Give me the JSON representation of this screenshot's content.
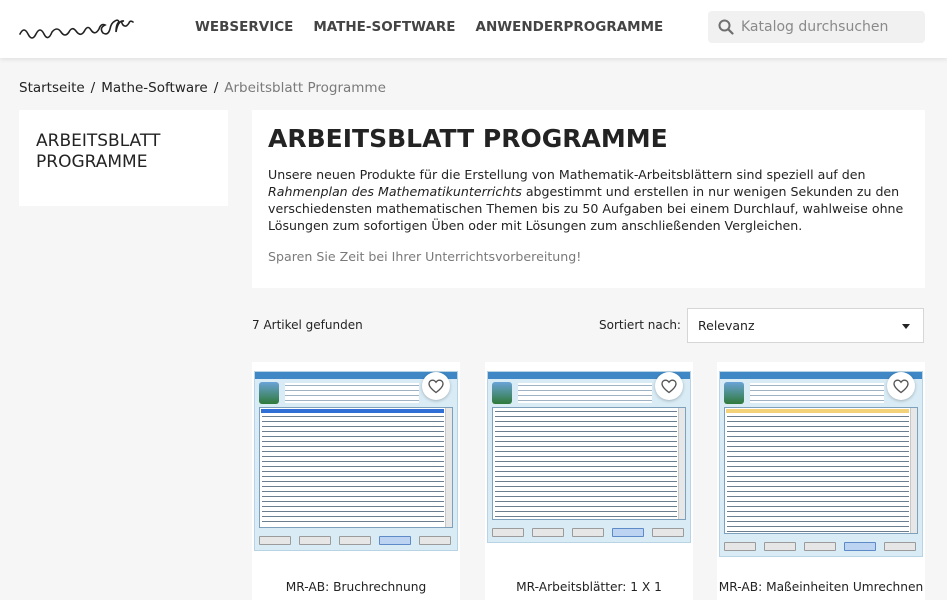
{
  "header": {
    "logo_text": "rumsoft",
    "nav": [
      "WEBSERVICE",
      "MATHE-SOFTWARE",
      "ANWENDERPROGRAMME"
    ],
    "search_placeholder": "Katalog durchsuchen"
  },
  "breadcrumb": {
    "items": [
      "Startseite",
      "Mathe-Software"
    ],
    "separator": "/",
    "current": "Arbeitsblatt Programme"
  },
  "sidebar": {
    "category_title": "ARBEITSBLATT PROGRAMME"
  },
  "category": {
    "title": "ARBEITSBLATT PROGRAMME",
    "desc_part1": "Unsere neuen Produkte für die Erstellung von Mathematik-Arbeitsblättern sind speziell auf den ",
    "desc_italic": "Rahmenplan des Mathematikunterrichts",
    "desc_part2": " abgestimmt und erstellen in nur wenigen Sekunden zu den verschiedensten mathematischen Themen bis zu 50 Aufgaben bei einem Durchlauf, wahlweise ohne Lösungen zum sofortigen Üben oder mit Lösungen zum anschließenden Vergleichen.",
    "tagline": "Sparen Sie Zeit bei Ihrer Unterrichtsvorbereitung!"
  },
  "listing": {
    "count_text": "7 Artikel gefunden",
    "sort_label": "Sortiert nach:",
    "sort_value": "Relevanz"
  },
  "products": [
    {
      "name": "MR-AB: Bruchrechnung"
    },
    {
      "name": "MR-Arbeitsblätter: 1 X 1"
    },
    {
      "name": "MR-AB: Maßeinheiten Umrechnen"
    }
  ],
  "colors": {
    "background": "#f6f6f6",
    "text": "#232323",
    "muted": "#7a7a7a",
    "screenshot_titlebar": "#3f88c5"
  }
}
